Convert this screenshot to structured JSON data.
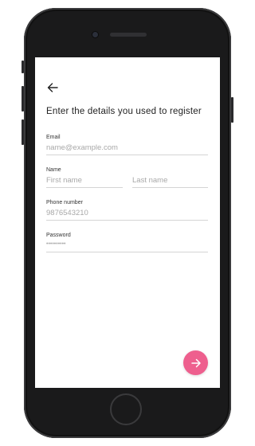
{
  "screen": {
    "heading": "Enter the details you used to register"
  },
  "form": {
    "email": {
      "label": "Email",
      "placeholder": "name@example.com"
    },
    "name": {
      "label": "Name",
      "first_placeholder": "First name",
      "last_placeholder": "Last name"
    },
    "phone": {
      "label": "Phone number",
      "placeholder": "9876543210"
    },
    "password": {
      "label": "Password",
      "placeholder": "••••••••••"
    }
  },
  "icons": {
    "back": "arrow-left-icon",
    "next": "arrow-right-icon"
  },
  "colors": {
    "accent": "#ee5f8e",
    "phone_body": "#1a1a1b",
    "field_underline": "#d4d4d4",
    "placeholder": "#a8a8a8"
  }
}
